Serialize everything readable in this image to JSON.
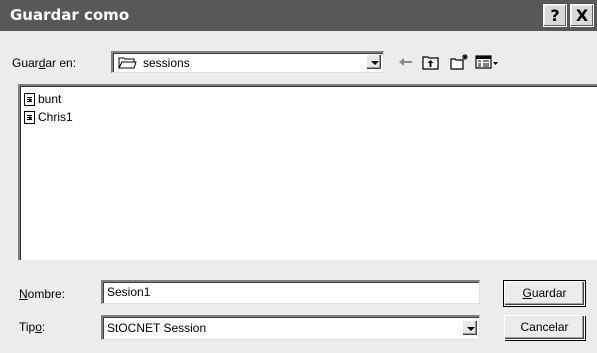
{
  "window": {
    "title": "Guardar como",
    "help_glyph": "?",
    "close_glyph": "X"
  },
  "save_in": {
    "label_pre": "Guar",
    "label_accel": "d",
    "label_post": "ar en:",
    "selected": "sessions",
    "icon": "folder-icon"
  },
  "toolbar": {
    "back_icon": "back-arrow-icon",
    "up_icon": "up-folder-icon",
    "new_folder_icon": "new-folder-icon",
    "view_menu_icon": "view-menu-icon"
  },
  "files": [
    {
      "name": "bunt",
      "icon": "document-icon"
    },
    {
      "name": "Chris1",
      "icon": "document-icon"
    }
  ],
  "name_field": {
    "label_accel": "N",
    "label_post": "ombre:",
    "value": "Sesion1"
  },
  "type_field": {
    "label_pre": "Tip",
    "label_accel": "o",
    "label_post": ":",
    "selected": "StOCNET Session"
  },
  "buttons": {
    "save_accel": "G",
    "save_post": "uardar",
    "cancel": "Cancelar"
  }
}
